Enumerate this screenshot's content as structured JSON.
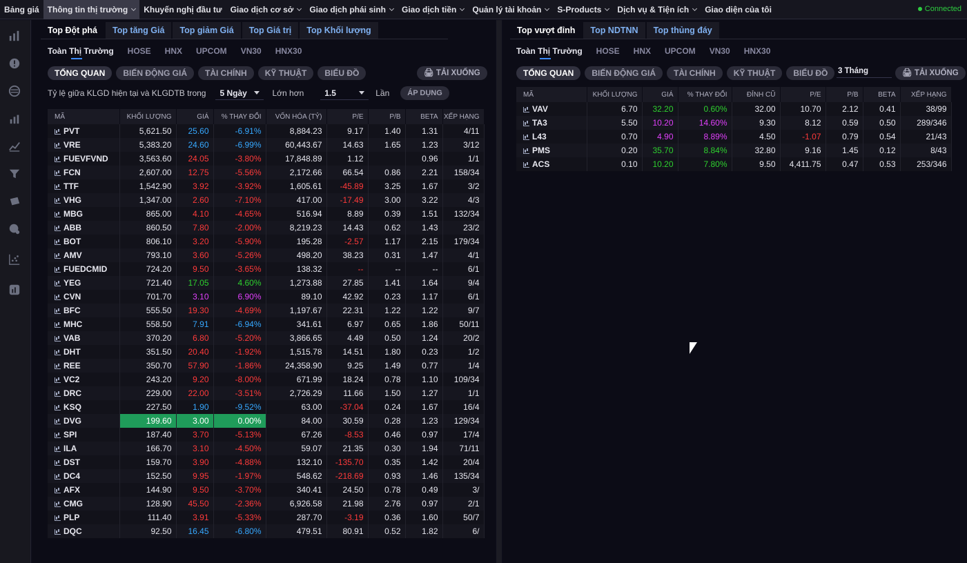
{
  "nav": {
    "items": [
      "Bảng giá",
      "Thông tin thị trường",
      "Khuyến nghị đầu tư",
      "Giao dịch cơ sở",
      "Giao dịch phái sinh",
      "Giao dịch tiền",
      "Quản lý tài khoản",
      "S-Products",
      "Dịch vụ & Tiện ích",
      "Giao diện của tôi"
    ],
    "connected": "Connected"
  },
  "left": {
    "tabs": [
      "Top Đột phá",
      "Top tăng Giá",
      "Top giảm Giá",
      "Top Giá trị",
      "Top Khối lượng"
    ],
    "exchanges": [
      "Toàn Thị Trường",
      "HOSE",
      "HNX",
      "UPCOM",
      "VN30",
      "HNX30"
    ],
    "views": [
      "TỔNG QUAN",
      "BIẾN ĐỘNG GIÁ",
      "TÀI CHÍNH",
      "KỸ THUẬT",
      "BIỂU ĐỒ"
    ],
    "download": "TẢI XUỐNG",
    "filter": {
      "label": "Tỷ lệ giữa KLGD hiện tại và KLGDTB trong",
      "days": "5 Ngày",
      "gt": "Lớn hơn",
      "ratio": "1.5",
      "times": "Lần",
      "apply": "ÁP DỤNG"
    },
    "columns": [
      "MÃ",
      "KHỐI LƯỢNG",
      "GIÁ",
      "% THAY ĐỔI",
      "VỐN HÓA (TỶ)",
      "P/E",
      "P/B",
      "BETA",
      "XẾP HẠNG"
    ],
    "rows": [
      [
        "PVT",
        "5,621.50",
        "25.60",
        "-6.91%",
        "8,884.23",
        "9.17",
        "1.40",
        "1.31",
        "4/11",
        "fl"
      ],
      [
        "VRE",
        "5,383.20",
        "24.60",
        "-6.99%",
        "60,443.67",
        "14.63",
        "1.65",
        "1.23",
        "3/12",
        "fl"
      ],
      [
        "FUEVFVND",
        "3,563.60",
        "24.05",
        "-3.80%",
        "17,848.89",
        "1.12",
        "",
        "0.96",
        "1/1",
        "dn"
      ],
      [
        "FCN",
        "2,607.00",
        "12.75",
        "-5.56%",
        "2,172.66",
        "66.54",
        "0.86",
        "2.21",
        "158/34",
        "dn"
      ],
      [
        "TTF",
        "1,542.90",
        "3.92",
        "-3.92%",
        "1,605.61",
        "-45.89",
        "3.25",
        "1.67",
        "3/2",
        "dn"
      ],
      [
        "VHG",
        "1,347.00",
        "2.60",
        "-7.10%",
        "417.00",
        "-17.49",
        "3.00",
        "3.22",
        "4/3",
        "dn"
      ],
      [
        "MBG",
        "865.00",
        "4.10",
        "-4.65%",
        "516.94",
        "8.89",
        "0.39",
        "1.51",
        "132/34",
        "dn"
      ],
      [
        "ABB",
        "860.50",
        "7.80",
        "-2.00%",
        "8,219.23",
        "14.43",
        "0.62",
        "1.43",
        "23/2",
        "dn"
      ],
      [
        "BOT",
        "806.10",
        "3.20",
        "-5.90%",
        "195.28",
        "-2.57",
        "1.17",
        "2.15",
        "179/34",
        "dn"
      ],
      [
        "AMV",
        "793.10",
        "3.60",
        "-5.26%",
        "498.20",
        "38.23",
        "0.31",
        "1.47",
        "4/1",
        "dn"
      ],
      [
        "FUEDCMID",
        "724.20",
        "9.50",
        "-3.65%",
        "138.32",
        "--",
        "--",
        "--",
        "6/1",
        "dn"
      ],
      [
        "YEG",
        "721.40",
        "17.05",
        "4.60%",
        "1,273.88",
        "27.85",
        "1.41",
        "1.64",
        "9/4",
        "up"
      ],
      [
        "CVN",
        "701.70",
        "3.10",
        "6.90%",
        "89.10",
        "42.92",
        "0.23",
        "1.17",
        "6/1",
        "ce"
      ],
      [
        "BFC",
        "555.50",
        "19.30",
        "-4.69%",
        "1,197.67",
        "22.31",
        "1.22",
        "1.22",
        "9/7",
        "dn"
      ],
      [
        "MHC",
        "558.50",
        "7.91",
        "-6.94%",
        "341.61",
        "6.97",
        "0.65",
        "1.86",
        "50/11",
        "fl"
      ],
      [
        "VAB",
        "370.20",
        "6.80",
        "-5.20%",
        "3,866.65",
        "4.49",
        "0.50",
        "1.24",
        "20/2",
        "dn"
      ],
      [
        "DHT",
        "351.50",
        "20.40",
        "-1.92%",
        "1,515.78",
        "14.51",
        "1.80",
        "0.23",
        "1/2",
        "dn"
      ],
      [
        "REE",
        "350.70",
        "57.90",
        "-1.86%",
        "24,358.90",
        "9.25",
        "1.49",
        "0.77",
        "1/4",
        "dn"
      ],
      [
        "VC2",
        "243.20",
        "9.20",
        "-8.00%",
        "671.99",
        "18.24",
        "0.78",
        "1.10",
        "109/34",
        "dn"
      ],
      [
        "DRC",
        "229.00",
        "22.00",
        "-3.51%",
        "2,726.29",
        "11.66",
        "1.50",
        "1.27",
        "1/1",
        "dn"
      ],
      [
        "KSQ",
        "227.50",
        "1.90",
        "-9.52%",
        "63.00",
        "-37.04",
        "0.24",
        "1.67",
        "16/4",
        "fl"
      ],
      [
        "DVG",
        "199.60",
        "3.00",
        "0.00%",
        "84.00",
        "30.59",
        "0.28",
        "1.23",
        "129/34",
        "ref"
      ],
      [
        "SPI",
        "187.40",
        "3.70",
        "-5.13%",
        "67.26",
        "-8.53",
        "0.46",
        "0.97",
        "17/4",
        "dn"
      ],
      [
        "ILA",
        "166.70",
        "3.10",
        "-4.50%",
        "59.07",
        "21.35",
        "0.30",
        "1.94",
        "71/11",
        "dn"
      ],
      [
        "DST",
        "159.70",
        "3.90",
        "-4.88%",
        "132.10",
        "-135.70",
        "0.35",
        "1.42",
        "20/4",
        "dn"
      ],
      [
        "DC4",
        "152.50",
        "9.95",
        "-1.97%",
        "548.62",
        "-218.69",
        "0.93",
        "1.46",
        "135/34",
        "dn"
      ],
      [
        "AFX",
        "144.90",
        "9.50",
        "-3.70%",
        "340.41",
        "24.50",
        "0.78",
        "0.49",
        "3/",
        "dn"
      ],
      [
        "CMG",
        "128.90",
        "45.50",
        "-2.36%",
        "6,926.58",
        "21.98",
        "2.76",
        "0.97",
        "2/1",
        "dn"
      ],
      [
        "PLP",
        "111.40",
        "3.91",
        "-5.33%",
        "287.70",
        "-3.19",
        "0.36",
        "1.60",
        "50/7",
        "dn"
      ],
      [
        "DQC",
        "92.50",
        "16.45",
        "-6.80%",
        "479.51",
        "80.91",
        "0.52",
        "1.82",
        "6/",
        "fl"
      ]
    ]
  },
  "right": {
    "tabs": [
      "Top vượt đỉnh",
      "Top NDTNN",
      "Top thủng đáy"
    ],
    "exchanges": [
      "Toàn Thị Trường",
      "HOSE",
      "HNX",
      "UPCOM",
      "VN30",
      "HNX30"
    ],
    "views": [
      "TỔNG QUAN",
      "BIẾN ĐỘNG GIÁ",
      "TÀI CHÍNH",
      "KỸ THUẬT",
      "BIỂU ĐỒ"
    ],
    "period": "3 Tháng",
    "download": "TẢI XUỐNG",
    "columns": [
      "MÃ",
      "KHỐI LƯỢNG",
      "GIÁ",
      "% THAY ĐỔI",
      "ĐỈNH CŨ",
      "P/E",
      "P/B",
      "BETA",
      "XẾP HẠNG"
    ],
    "rows": [
      [
        "VAV",
        "6.70",
        "32.20",
        "0.60%",
        "32.00",
        "10.70",
        "2.12",
        "0.41",
        "38/99",
        "up"
      ],
      [
        "TA3",
        "5.50",
        "10.20",
        "14.60%",
        "9.30",
        "8.12",
        "0.59",
        "0.50",
        "289/346",
        "ce"
      ],
      [
        "L43",
        "0.70",
        "4.90",
        "8.89%",
        "4.50",
        "-1.07",
        "0.79",
        "0.54",
        "21/43",
        "ce"
      ],
      [
        "PMS",
        "0.20",
        "35.70",
        "8.84%",
        "32.80",
        "9.16",
        "1.45",
        "0.12",
        "8/43",
        "up"
      ],
      [
        "ACS",
        "0.10",
        "10.20",
        "7.80%",
        "9.50",
        "4,411.75",
        "0.47",
        "0.53",
        "253/346",
        "up"
      ]
    ]
  },
  "colors": {
    "up": "#2ed02e",
    "down": "#ff3a3a",
    "ceiling": "#e040fb",
    "floor": "#36a8ff",
    "reference": "#f5c623",
    "highlight": "#1f9c5a"
  },
  "sidebar_icons": [
    "bar-chart-icon",
    "alert-circle-icon",
    "globe-icon",
    "analytics-icon",
    "line-chart-icon",
    "filter-icon",
    "ticket-icon",
    "coin-settings-icon",
    "scatter-chart-icon",
    "report-icon"
  ]
}
